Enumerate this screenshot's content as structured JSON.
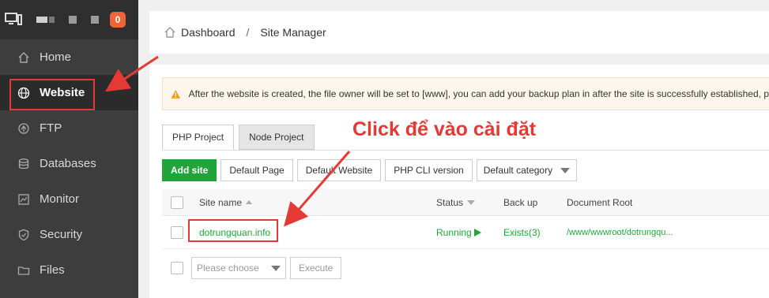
{
  "topbar": {
    "badge_count": "0"
  },
  "sidebar": {
    "items": [
      {
        "label": "Home",
        "icon": "home-icon"
      },
      {
        "label": "Website",
        "icon": "globe-icon"
      },
      {
        "label": "FTP",
        "icon": "ftp-icon"
      },
      {
        "label": "Databases",
        "icon": "database-icon"
      },
      {
        "label": "Monitor",
        "icon": "monitor-icon"
      },
      {
        "label": "Security",
        "icon": "shield-icon"
      },
      {
        "label": "Files",
        "icon": "folder-icon"
      }
    ]
  },
  "breadcrumb": {
    "home": "Dashboard",
    "separator": "/",
    "current": "Site Manager"
  },
  "alert": {
    "text": "After the website is created, the file owner will be set to [www], you can add your backup plan in after the site is successfully established, p"
  },
  "tabs": [
    {
      "label": "PHP Project"
    },
    {
      "label": "Node Project"
    }
  ],
  "toolbar": {
    "add_site": "Add site",
    "default_page": "Default Page",
    "default_website": "Default Website",
    "php_cli_version": "PHP CLI version",
    "category_select": "Default category"
  },
  "table": {
    "headers": {
      "site_name": "Site name",
      "status": "Status",
      "backup": "Back up",
      "document_root": "Document Root"
    },
    "rows": [
      {
        "site_name": "dotrungquan.info",
        "status": "Running",
        "backup": "Exists(3)",
        "document_root": "/www/wwwroot/dotrungqu..."
      }
    ]
  },
  "bulk": {
    "placeholder": "Please choose",
    "execute": "Execute"
  },
  "annotation": {
    "callout": "Click để vào cài đặt"
  },
  "colors": {
    "accent_green": "#20a53a",
    "annotation_red": "#e53935",
    "badge_orange": "#f0643a"
  }
}
